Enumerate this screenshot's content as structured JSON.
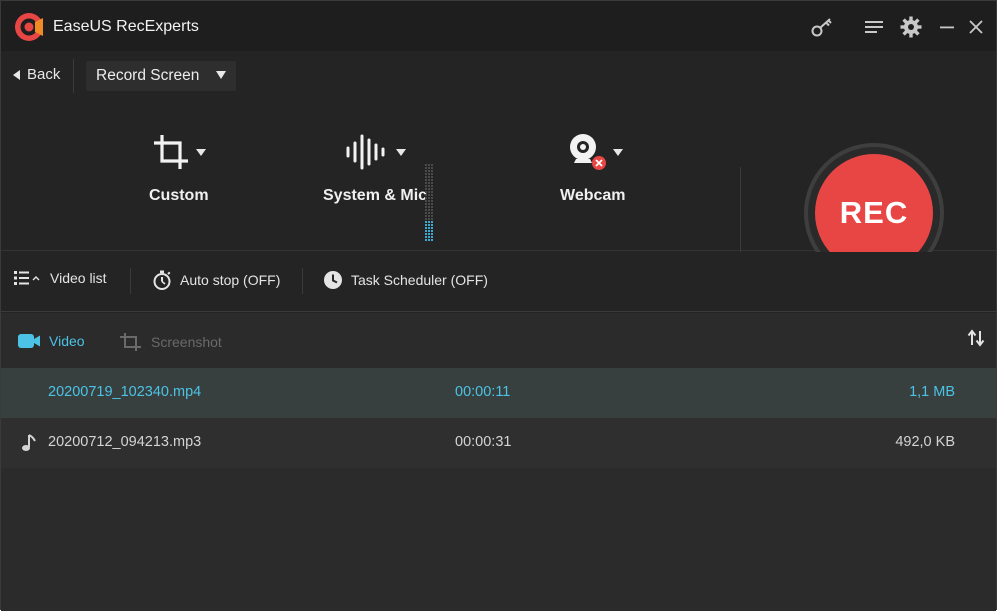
{
  "app": {
    "title": "EaseUS RecExperts"
  },
  "topbar": {
    "back_label": "Back",
    "mode_selected": "Record Screen"
  },
  "sources": {
    "region": {
      "label": "Custom"
    },
    "audio": {
      "label": "System & Mic"
    },
    "webcam": {
      "label": "Webcam"
    }
  },
  "rec": {
    "label": "REC",
    "color": "#e84545"
  },
  "toolbar": {
    "video_list": "Video list",
    "auto_stop": "Auto stop (OFF)",
    "task_scheduler": "Task Scheduler (OFF)"
  },
  "tabs": {
    "video": "Video",
    "screenshot": "Screenshot"
  },
  "files": [
    {
      "name": "20200719_102340.mp4",
      "duration": "00:00:11",
      "size": "1,1 MB",
      "type": "video",
      "selected": true
    },
    {
      "name": "20200712_094213.mp3",
      "duration": "00:00:31",
      "size": "492,0 KB",
      "type": "audio",
      "selected": false
    }
  ],
  "icons": {
    "titlebar": [
      "key-icon",
      "menu-icon",
      "gear-icon",
      "minimize-icon",
      "close-icon"
    ],
    "accent": "#4cc3e6"
  }
}
